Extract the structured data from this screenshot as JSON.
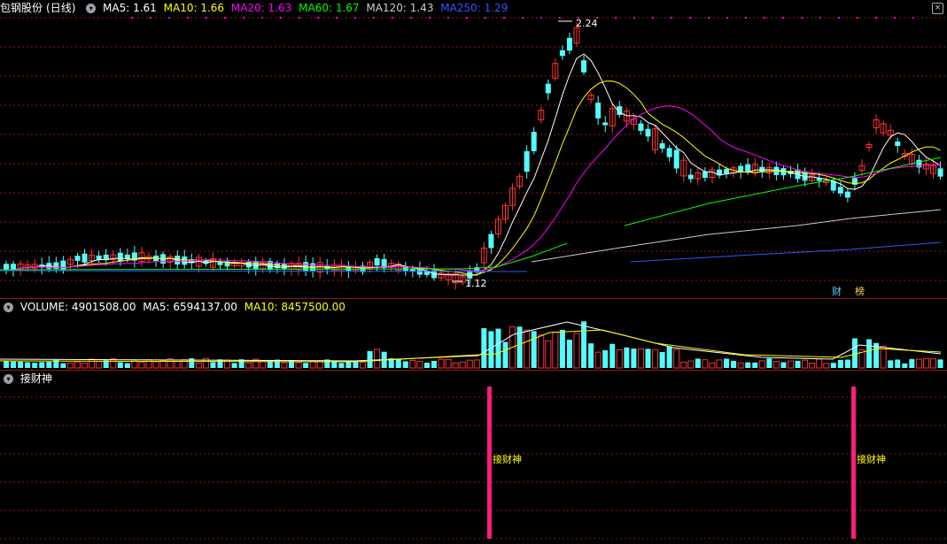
{
  "main": {
    "stock_name": "包钢股份",
    "period": "(日线)",
    "ma": [
      {
        "label": "MA5: 1.61",
        "color": "#ffffff"
      },
      {
        "label": "MA10: 1.66",
        "color": "#ffff00"
      },
      {
        "label": "MA20: 1.63",
        "color": "#ff00ff"
      },
      {
        "label": "MA60: 1.67",
        "color": "#00ff00"
      },
      {
        "label": "MA120: 1.43",
        "color": "#cccccc"
      },
      {
        "label": "MA250: 1.29",
        "color": "#3355ff"
      }
    ],
    "high_label": "2.24",
    "low_label": "1.12",
    "tag_cai": "财",
    "tag_bang": "榜"
  },
  "volume": {
    "title": "VOLUME: 4901508.00",
    "ma5": "MA5: 6594137.00",
    "ma10": "MA10: 8457500.00"
  },
  "indicator": {
    "title": "接财神",
    "signal_label_1": "接财神",
    "signal_label_2": "接财神"
  },
  "colors": {
    "up": "#ff3232",
    "down": "#54fcfc",
    "grid": "#8b1a1a",
    "signal": "#ff1c7c"
  }
}
